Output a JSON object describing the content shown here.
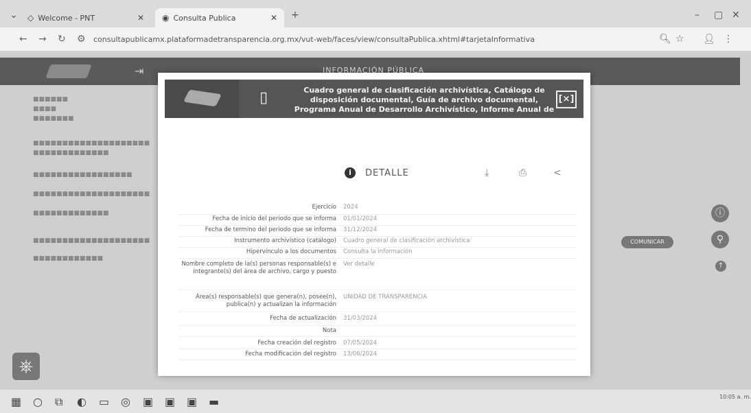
{
  "browser": {
    "tabs": [
      {
        "title": "Welcome - PNT"
      },
      {
        "title": "Consulta Publica"
      }
    ],
    "url": "consultapublicamx.plataformadetransparencia.org.mx/vut-web/faces/view/consultaPublica.xhtml#tarjetaInformativa"
  },
  "page": {
    "header_title": "INFORMACIÓN PÚBLICA",
    "comunicar_label": "COMUNICAR"
  },
  "modal": {
    "title": "Cuadro general de clasificación archivística, Catálogo de disposición documental, Guía de archivo documental, Programa Anual de Desarrollo Archivístico, Informe Anual de",
    "close_label": "[×]",
    "detalle_label": "DETALLE",
    "rows": [
      {
        "label": "Ejercicio",
        "value": "2024"
      },
      {
        "label": "Fecha de inicio del periodo que se informa",
        "value": "01/01/2024"
      },
      {
        "label": "Fecha de termino del periodo que se informa",
        "value": "31/12/2024"
      },
      {
        "label": "Instrumento archivístico (catálogo)",
        "value": "Cuadro general de clasificación archivística"
      },
      {
        "label": "Hipervínculo a los documentos",
        "value": "Consulta la información"
      },
      {
        "label": "Nombre completo de la(s) personas responsable(s) e integrante(s) del área de archivo, cargo y puesto",
        "value": "Ver detalle"
      },
      {
        "label": "Área(s) responsable(s) que genera(n), posee(n), publica(n) y actualizan la información",
        "value": "UNIDAD DE TRANSPARENCIA"
      },
      {
        "label": "Fecha de actualización",
        "value": "31/03/2024"
      },
      {
        "label": "Nota",
        "value": ""
      },
      {
        "label": "Fecha creación del registro",
        "value": "07/05/2024"
      },
      {
        "label": "Fecha modificación del registro",
        "value": "13/06/2024"
      }
    ]
  },
  "taskbar": {
    "time": "10:05 a. m."
  }
}
